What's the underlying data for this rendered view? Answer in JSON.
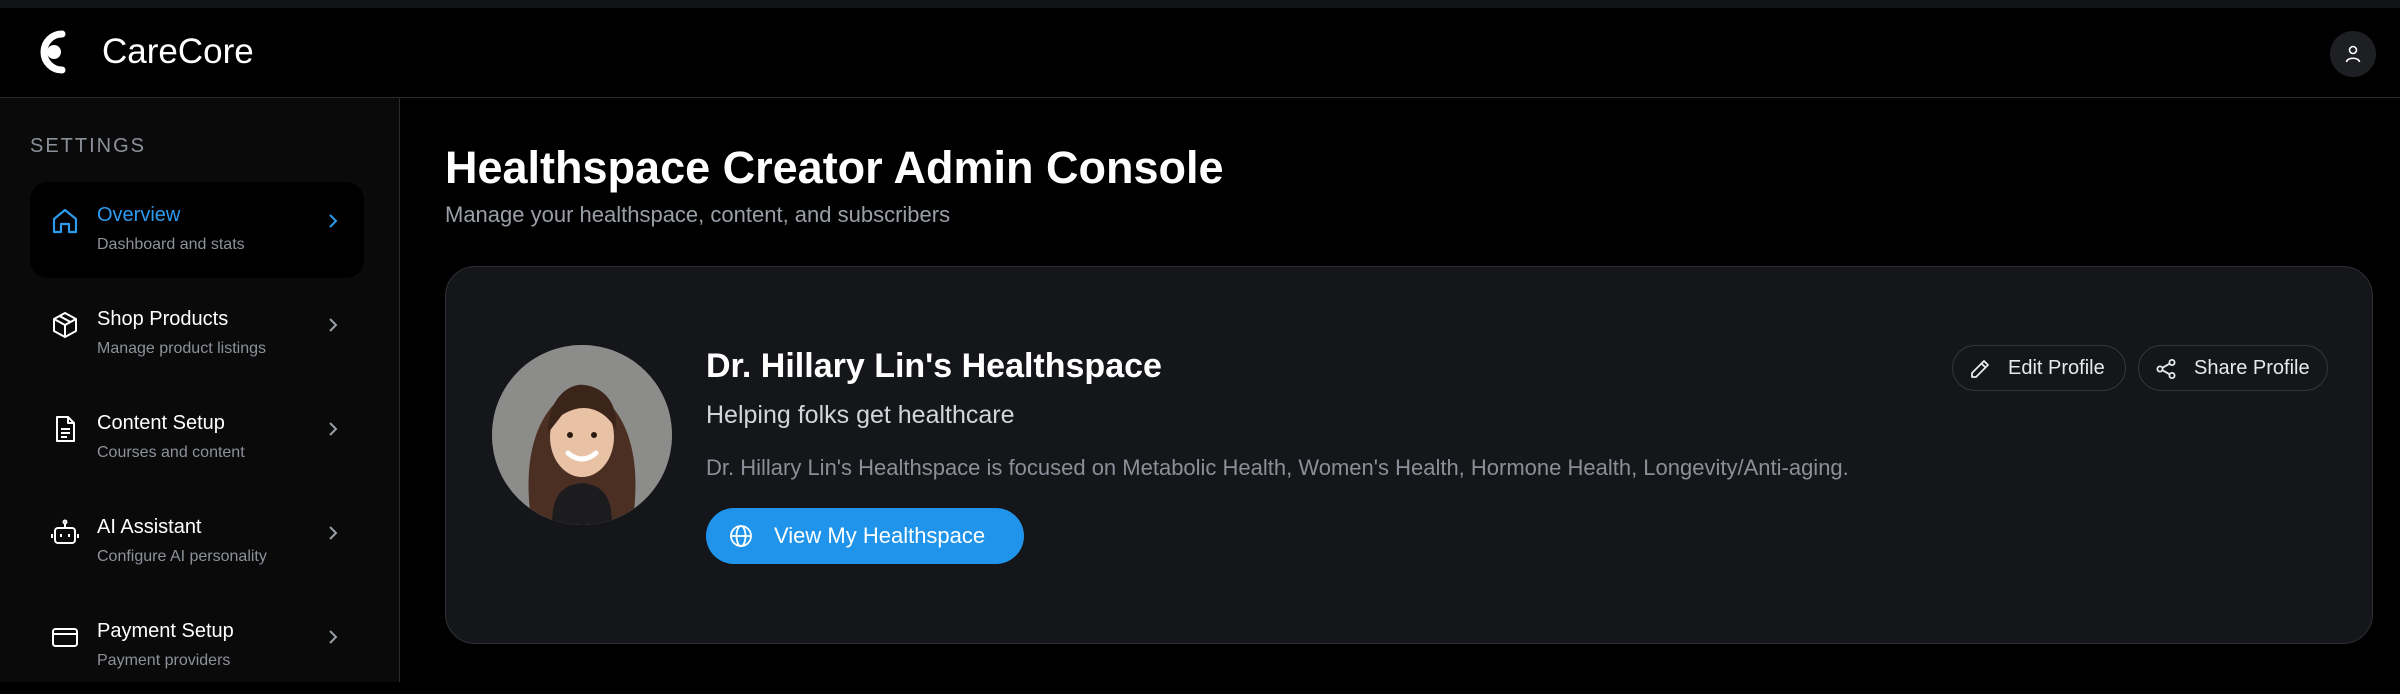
{
  "header": {
    "app_name": "CareCore",
    "logo_icon": "carecore-logo-icon",
    "user_icon": "user-icon"
  },
  "sidebar": {
    "section_label": "SETTINGS",
    "items": [
      {
        "title": "Overview",
        "subtitle": "Dashboard and stats",
        "icon": "home-icon",
        "active": true
      },
      {
        "title": "Shop Products",
        "subtitle": "Manage product listings",
        "icon": "package-icon",
        "active": false
      },
      {
        "title": "Content Setup",
        "subtitle": "Courses and content",
        "icon": "document-icon",
        "active": false
      },
      {
        "title": "AI Assistant",
        "subtitle": "Configure AI personality",
        "icon": "bot-icon",
        "active": false
      },
      {
        "title": "Payment Setup",
        "subtitle": "Payment providers",
        "icon": "credit-card-icon",
        "active": false
      }
    ]
  },
  "main": {
    "title": "Healthspace Creator Admin Console",
    "subtitle": "Manage your healthspace, content, and subscribers",
    "profile_card": {
      "name": "Dr. Hillary Lin's Healthspace",
      "tagline": "Helping folks get healthcare",
      "description": "Dr. Hillary Lin's Healthspace is focused on Metabolic Health, Women's Health, Hormone Health, Longevity/Anti-aging.",
      "view_button": "View My Healthspace",
      "edit_button": "Edit Profile",
      "share_button": "Share Profile"
    }
  },
  "colors": {
    "accent": "#1f94ea",
    "active_nav_text": "#2d9bef",
    "background": "#000000",
    "card_bg": "#15161a"
  }
}
